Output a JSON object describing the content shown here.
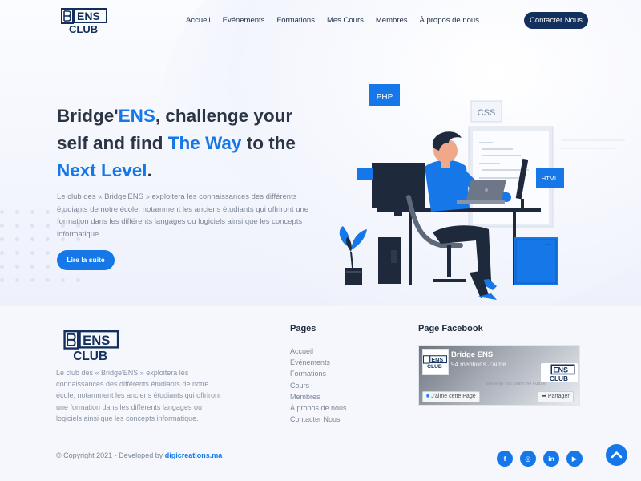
{
  "brand": {
    "logo_text_top": "ENS",
    "logo_text_bottom": "CLUB",
    "logo_letters": "B",
    "accent_color": "#1677e8",
    "navy_color": "#13305c"
  },
  "nav": {
    "items": [
      {
        "label": "Accueil"
      },
      {
        "label": "Evénements"
      },
      {
        "label": "Formations"
      },
      {
        "label": "Mes Cours"
      },
      {
        "label": "Membres"
      },
      {
        "label": "À propos de nous"
      }
    ],
    "contact_label": "Contacter Nous"
  },
  "hero": {
    "headline": {
      "p1": "Bridge'",
      "h1": "ENS",
      "p2": ", challenge your self and find ",
      "h2": "The Way",
      "p3": " to the ",
      "h3": "Next Level",
      "p4": "."
    },
    "lead": "Le club des « Bridge'ENS » exploitera les connaissances des différents étudiants de notre école, notamment les anciens étudiants qui offriront une formation dans les différents langages ou logiciels ainsi que les concepts informatique.",
    "cta_label": "Lire la suite"
  },
  "illustration": {
    "tags": {
      "php": "PHP",
      "css": "CSS",
      "html": "HTML"
    }
  },
  "footer": {
    "description": "Le club des « Bridge'ENS » exploitera les connaissances des différents étudiants de notre école, notamment les anciens étudiants qui offriront une formation dans les différents langages ou logiciels ainsi que les concepts informatique.",
    "pages_title": "Pages",
    "pages": [
      {
        "label": "Accueil"
      },
      {
        "label": "Evénements"
      },
      {
        "label": "Formations"
      },
      {
        "label": "Cours"
      },
      {
        "label": "Membres"
      },
      {
        "label": "À propos de nous"
      },
      {
        "label": "Contacter Nous"
      }
    ],
    "facebook_title": "Page Facebook",
    "facebook": {
      "page_name": "Bridge ENS",
      "likes": "94 mentions J'aime",
      "like_button": "J'aime cette Page",
      "share_button": "Partager",
      "tagline": "\"We Help You Learn the Future\""
    },
    "copyright_prefix": "© Copyright 2021 - Developed by ",
    "copyright_link": "digicreations.ma",
    "socials": [
      {
        "icon": "facebook-icon",
        "glyph": "f"
      },
      {
        "icon": "instagram-icon",
        "glyph": "◎"
      },
      {
        "icon": "linkedin-icon",
        "glyph": "in"
      },
      {
        "icon": "youtube-icon",
        "glyph": "▶"
      }
    ]
  }
}
